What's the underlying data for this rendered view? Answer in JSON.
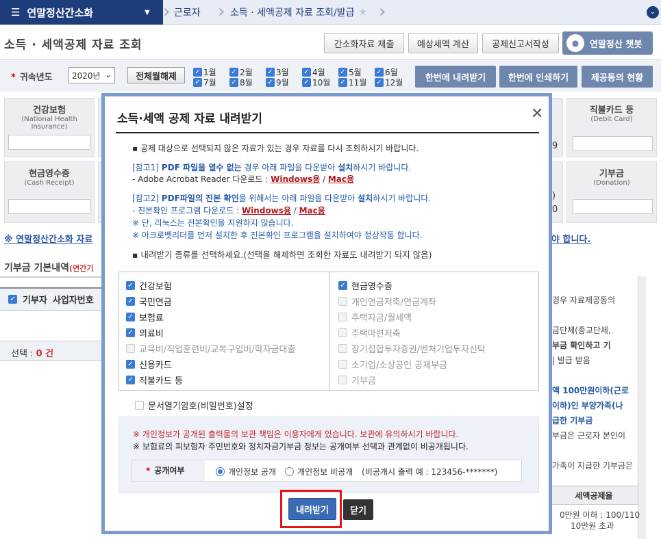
{
  "nav": {
    "menu_label": "연말정산간소화",
    "crumbs": [
      "근로자",
      "소득 · 세액공제 자료 조회/발급"
    ]
  },
  "page": {
    "title": "소득 · 세액공제 자료 조회",
    "buttons": [
      "간소화자료 제출",
      "예상세액 계산",
      "공제신고서작성"
    ],
    "chatbot": "연말정산 챗봇"
  },
  "filter": {
    "year_label": "귀속년도",
    "year_value": "2020년",
    "clear_label": "전체월해제",
    "months": [
      "1월",
      "2월",
      "3월",
      "4월",
      "5월",
      "6월",
      "7월",
      "8월",
      "9월",
      "10월",
      "11월",
      "12월"
    ],
    "actions": [
      "한번에 내려받기",
      "한번에 인쇄하기",
      "제공동의 현황"
    ]
  },
  "cards": {
    "health": {
      "title": "건강보험",
      "sub1": "(National Health",
      "sub2": "Insurance)"
    },
    "cash": {
      "title": "현금영수증",
      "sub1": "(Cash Receipt)"
    },
    "debit": {
      "title": "직불카드 등",
      "sub1": "(Debit Card)"
    },
    "donation": {
      "title": "기부금",
      "sub1": "(Donation)"
    },
    "frag_a": "9",
    "frag_b": ")",
    "frag_c": "0"
  },
  "background": {
    "notice_link": "※ 연말정산간소화 자료",
    "right_notice": "야 합니다.",
    "donate_title": "기부금 기본내역",
    "donate_sub": "(연간기",
    "grid_col1": "기부자",
    "grid_col2": "사업자번호",
    "select_label": "선택 : ",
    "select_count": "0 건",
    "right_lines": [
      "경우 자료제공동의",
      "",
      "금단체(종교단체,",
      "부금 확인하고 기",
      "| 발급 받음",
      "",
      "액 100만원이하(근로",
      "이하)인 부양가족(나",
      "급한 기부금",
      "부금은 근로자 본인이",
      "",
      "가족이 지급한 기부금은"
    ],
    "rp_head": "세액공제율",
    "rp_tail1": "0만원 이하 : 100/110",
    "rp_tail2": "10만원 초과"
  },
  "modal": {
    "title": "소득·세액 공제 자료 내려받기",
    "line1": "공제 대상으로 선택되지 않은 자료가 있는 경우 자료를 다시 조회하시기 바랍니다.",
    "ref1_prefix": "[참고1] ",
    "ref1_bold": "PDF 파일을 열수 없는",
    "ref1_mid": " 경우  아래 파일을 다운받아 ",
    "ref1_bold2": "설치",
    "ref1_suffix": "하시기 바랍니다.",
    "ref1_dl": "- Adobe Acrobat Reader 다운로드 : ",
    "windows": "Windows용",
    "mac": "Mac용",
    "slash": " / ",
    "ref2_prefix": "[참고2] ",
    "ref2_bold": "PDF파일의 진본 확인",
    "ref2_mid": "을 위해서는 아래 파일을 다운받아 ",
    "ref2_bold2": "설치",
    "ref2_suffix": "하시기 바랍니다.",
    "ref2_dl": "- 진본확인 프로그램 다운로드 : ",
    "note1": "※ 단, 리눅스는 진본확인을 지원하지 않습니다.",
    "note2": "※ 아크로벳리더를 먼저 설치한 후 진본확인 프로그램을 설치하여야 정상작동 합니다.",
    "choose": "내려받기 종류를 선택하세요.(선택을 해제하면 조회한 자료도 내려받기 되지 않음)",
    "left_items": [
      {
        "label": "건강보험",
        "state": "on"
      },
      {
        "label": "국민연금",
        "state": "on"
      },
      {
        "label": "보험료",
        "state": "on"
      },
      {
        "label": "의료비",
        "state": "on"
      },
      {
        "label": "교육비/직업훈련비/교복구입비/학자금대출",
        "state": "dis"
      },
      {
        "label": "신용카드",
        "state": "on"
      },
      {
        "label": "직불카드 등",
        "state": "on"
      }
    ],
    "right_items": [
      {
        "label": "현금영수증",
        "state": "on"
      },
      {
        "label": "개인연금저축/연금계좌",
        "state": "dis"
      },
      {
        "label": "주택자금/월세액",
        "state": "dis"
      },
      {
        "label": "주택마련저축",
        "state": "dis"
      },
      {
        "label": "장기집합투자증권/벤처기업투자신탁",
        "state": "dis"
      },
      {
        "label": "소기업/소상공인 공제부금",
        "state": "dis"
      },
      {
        "label": "기부금",
        "state": "dis"
      }
    ],
    "password": "문서열기암호(비밀번호)설정",
    "warn1": "※ 개인정보가 공개된 출력물의 보관 책임은 이용자에게 있습니다. 보관에 유의하시기 바랍니다.",
    "warn2": "※ 보험료의 피보험자 주민번호와 정치자금기부금 정보는 공개여부 선택과 관계없이 비공개됩니다.",
    "public_label": "공개여부",
    "public_on": "개인정보 공개",
    "public_off": "개인정보 비공개",
    "public_hint": "(비공개시 출력 예 : 123456-*******)",
    "download": "내려받기",
    "close": "닫기"
  }
}
